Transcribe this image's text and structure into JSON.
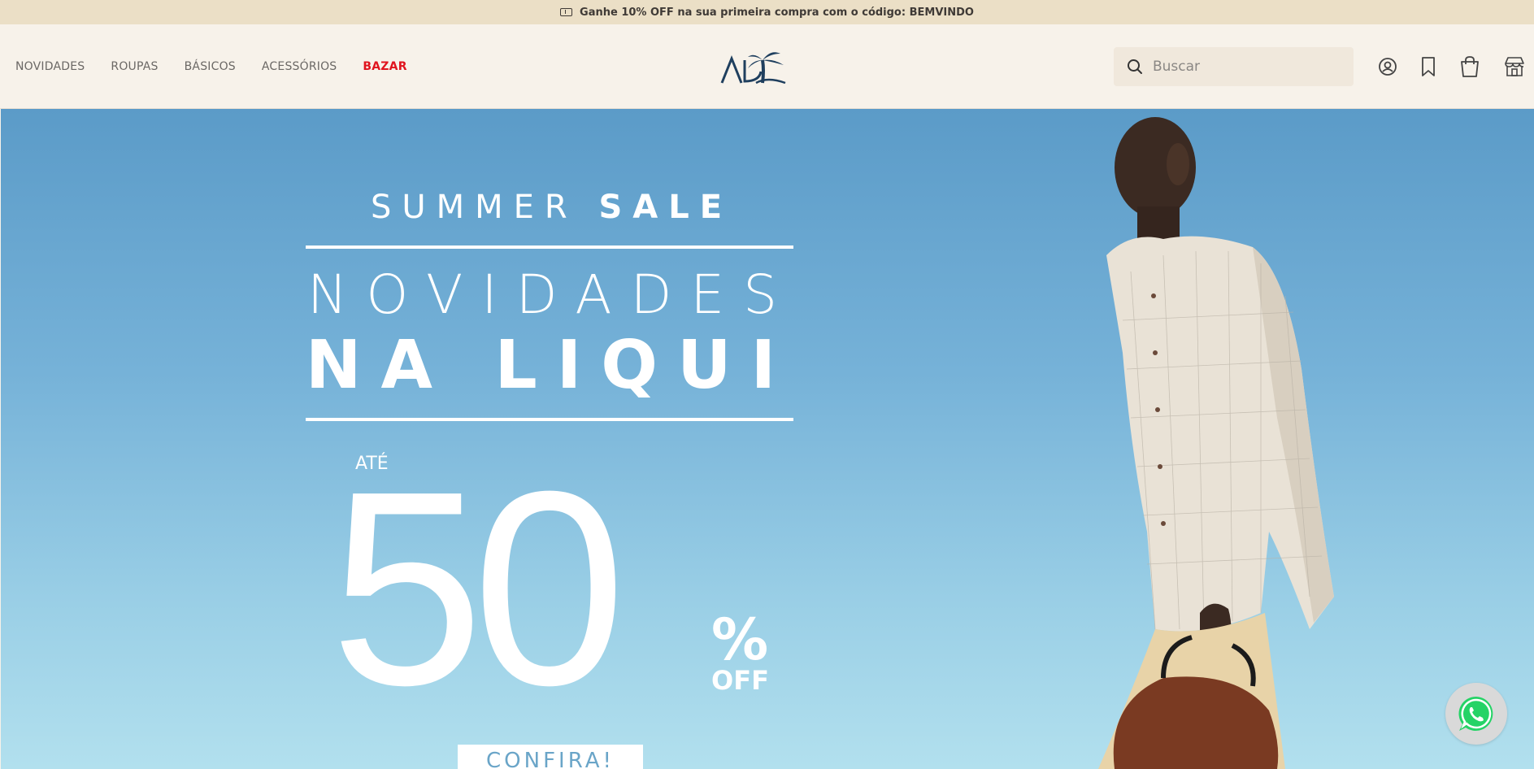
{
  "promo": {
    "icon": "ticket-icon",
    "text": "Ganhe 10% OFF na sua primeira compra com o código: BEMVINDO"
  },
  "nav": [
    {
      "label": "NOVIDADES"
    },
    {
      "label": "ROUPAS"
    },
    {
      "label": "BÁSICOS"
    },
    {
      "label": "ACESSÓRIOS"
    },
    {
      "label": "BAZAR",
      "color": "#e0141e"
    }
  ],
  "logo": {
    "text": "AD",
    "icon": "palm-tree-icon",
    "color": "#1f3f5e"
  },
  "search": {
    "placeholder": "Buscar",
    "value": "",
    "icon": "search-icon"
  },
  "header_icons": [
    "user-icon",
    "bookmark-icon",
    "shopping-bag-icon",
    "store-icon"
  ],
  "hero": {
    "eyebrow_light": "SUMMER",
    "eyebrow_bold": "SALE",
    "line1": "NOVIDADES",
    "line2": "NA LIQUI",
    "ate": "ATÉ",
    "discount": "50",
    "percent": "%",
    "off": "OFF",
    "cta": "CONFIRA!",
    "sky_color": "#76b2d8"
  },
  "whatsapp": {
    "icon": "whatsapp-icon",
    "color": "#25d366"
  }
}
